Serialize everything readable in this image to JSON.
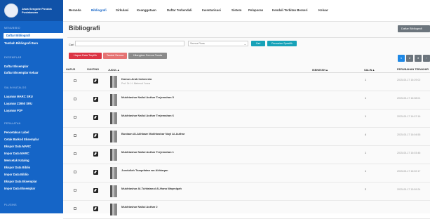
{
  "sidebar": {
    "brand": "Jawa Sengwie Pondok Pustakawan",
    "sections": [
      "MENUBIBIO",
      "EKSEMPLAR",
      "SALIN KATALOG",
      "PERALATAN",
      "PLUGINS"
    ],
    "items": [
      "Daftar Bibliografi",
      "Tambah Bibliografi Baru",
      "Daftar Eksemplar",
      "Daftar Eksemplar Keluar",
      "Layanan MARC SRU",
      "Layanan Z3950 SRU",
      "Layanan P2P",
      "Pencetakan Label",
      "Cetak Barkod Eksemplar",
      "Ekspor Data MARC",
      "Impor Data MARC",
      "Mencetak Katalog",
      "Ekspor Data Biblio",
      "Impor Data Biblio",
      "Ekspor Data Eksemplar",
      "Impor Data Eksemplar"
    ]
  },
  "topnav": [
    "Beranda",
    "Bibliografi",
    "Sirkulasi",
    "Keanggotaan",
    "Daftar Terkendali",
    "Inventarisasi",
    "Sistem",
    "Pelaporan",
    "Kendali Terbitan Berseri",
    "Keluar"
  ],
  "main": {
    "title": "Bibliografi",
    "right_button": "Daftar Bibliografi",
    "search_label": "Cari",
    "search_placeholder": "",
    "select_value": "Semua Ruas",
    "btn_cari": "Cari",
    "btn_spesifik": "Pencarian Spesifik",
    "btn_delete": "Hapus Data Terpilih",
    "btn_select_all": "Tandai Semua",
    "btn_unselect": "Hilangkan Semua Tanda",
    "pages": [
      "1",
      "2",
      "3",
      "›"
    ],
    "headers": {
      "hapus": "HAPUS",
      "sunting": "SUNTING",
      "judul": "JUDUL ▴",
      "isbn": "ISBN/ISSN ▴",
      "salin": "SALIN ▴",
      "perubahan": "PERUBAHAN TERAKHIR"
    },
    "rows": [
      {
        "title": "Kamus Arab Indonesia",
        "sub": "Prof. Dr. H. Mahmud Yunus",
        "salin": "1",
        "date": "2025-05-17 16:29:02"
      },
      {
        "title": "Mukhtashar Nailul Authar Terjemahan 5",
        "sub": "",
        "salin": "1",
        "date": "2025-05-17 16:08:01"
      },
      {
        "title": "Mukhtashar Nailul Authar Terjemahan 6",
        "sub": "",
        "salin": "1",
        "date": "2025-05-17 16:07:16"
      },
      {
        "title": "Bustaan Al-Akhbaar Mukhtashar Nayl Al-Authar",
        "sub": "",
        "salin": "4",
        "date": "2025-05-17 16:04:55"
      },
      {
        "title": "Mukhtashar Nailul Authar Terjemahan 1",
        "sub": "",
        "salin": "1",
        "date": "2025-05-17 16:03:46"
      },
      {
        "title": "Jundullah Tsaqofatan wa Akhlaqan",
        "sub": "",
        "salin": "1",
        "date": "2025-05-17 16:02:17"
      },
      {
        "title": "Mukhtashar Al-Tuhfatanul Al-Hana Waymigah",
        "sub": "",
        "salin": "2",
        "date": "2025-05-17 15:59:24"
      },
      {
        "title": "Mukhtashar Nailul Authar 2",
        "sub": "",
        "salin": "",
        "date": ""
      }
    ]
  }
}
